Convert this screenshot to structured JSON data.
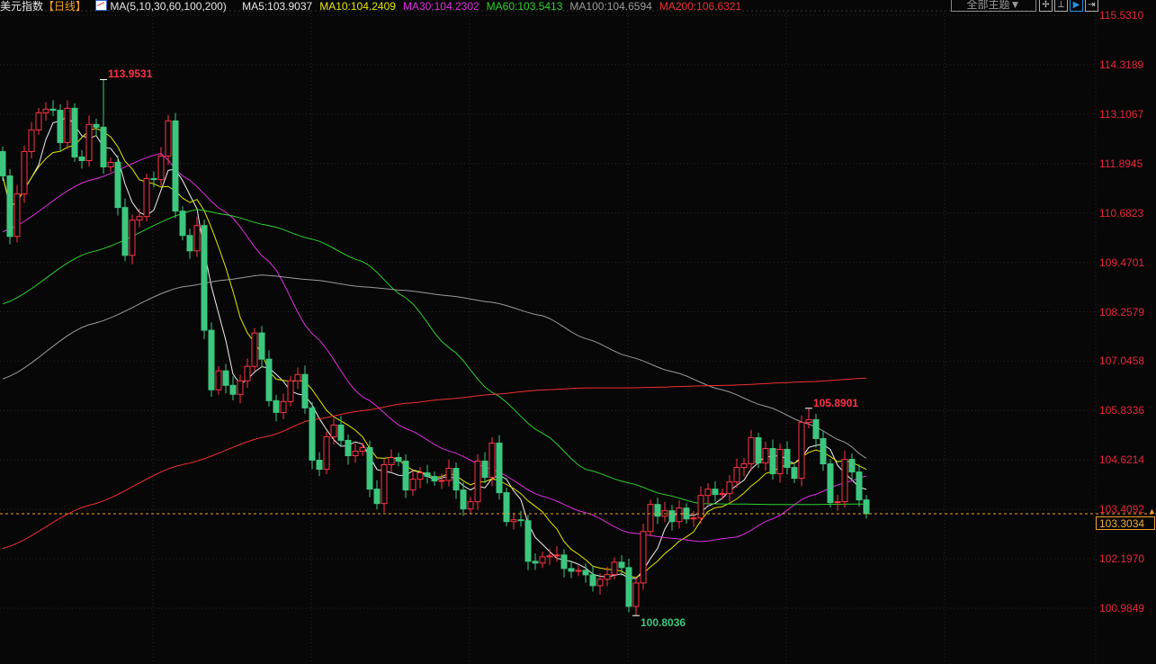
{
  "header": {
    "symbol": "美元指数",
    "period": "【日线】",
    "ma_group": "MA(5,10,30,60,100,200)",
    "ma_labels": [
      {
        "text": "MA5:103.9037",
        "color": "#e6e6e6"
      },
      {
        "text": "MA10:104.2409",
        "color": "#e6e600"
      },
      {
        "text": "MA30:104.2302",
        "color": "#e030e0"
      },
      {
        "text": "MA60:103.5413",
        "color": "#30d030"
      },
      {
        "text": "MA100:104.6594",
        "color": "#9a9a9a"
      },
      {
        "text": "MA200:106.6321",
        "color": "#f03030"
      }
    ],
    "theme_button": "全部主题▼",
    "toolbar_icons": [
      "crosshair-icon",
      "fit-icon",
      "play-icon",
      "expand-right-icon"
    ]
  },
  "colors": {
    "up": "#ff3344",
    "down": "#3cc77f",
    "bg": "#070707",
    "last_price": "#f0a030"
  },
  "chart_data": {
    "type": "candlestick",
    "title": "美元指数 日线",
    "ylim": [
      100.9849,
      115.531
    ],
    "y_ticks": [
      "115.5310",
      "114.3189",
      "113.1067",
      "111.8945",
      "110.6823",
      "109.4701",
      "108.2579",
      "107.0458",
      "105.8336",
      "104.6214",
      "103.4092",
      "102.1970",
      "100.9849"
    ],
    "first_open": 112.188,
    "closes": [
      111.59,
      110.106,
      111.147,
      112.188,
      112.719,
      113.14,
      113.228,
      113.2,
      112.409,
      113.25,
      112.055,
      111.966,
      112.852,
      112.786,
      111.811,
      111.922,
      110.815,
      109.641,
      110.505,
      110.594,
      111.524,
      111.5,
      112.077,
      112.941,
      110.727,
      110.129,
      109.752,
      110.372,
      107.804,
      106.343,
      106.807,
      106.453,
      106.232,
      106.564,
      106.918,
      107.737,
      107.095,
      106.077,
      105.789,
      106.055,
      106.564,
      106.719,
      105.9,
      104.616,
      104.394,
      105.191,
      105.479,
      105.103,
      104.726,
      104.837,
      104.925,
      103.907,
      103.553,
      104.505,
      104.682,
      104.593,
      103.885,
      104.15,
      104.305,
      104.217,
      104.106,
      104.12,
      104.416,
      103.885,
      103.42,
      103.597,
      104.593,
      104.195,
      105.036,
      103.819,
      103.11,
      103.154,
      103.132,
      102.136,
      102.092,
      102.246,
      102.269,
      102.291,
      101.959,
      101.892,
      101.915,
      101.804,
      101.538,
      101.693,
      101.81,
      102.114,
      101.981,
      101.029,
      101.605,
      102.866,
      103.531,
      103.243,
      103.376,
      103.11,
      103.442,
      103.176,
      103.198,
      103.752,
      103.907,
      103.774,
      103.796,
      104.084,
      104.438,
      104.527,
      105.169,
      104.549,
      104.903,
      104.283,
      104.881,
      104.438,
      104.172,
      105.545,
      105.611,
      105.147,
      104.527,
      103.575,
      103.597,
      104.637,
      104.327,
      103.642,
      103.3034
    ],
    "annotations": [
      {
        "index": 14,
        "kind": "high",
        "value": 113.9531,
        "label": "113.9531",
        "color": "#ff3344"
      },
      {
        "index": 88,
        "kind": "low",
        "value": 100.8036,
        "label": "100.8036",
        "color": "#3cc77f"
      },
      {
        "index": 112,
        "kind": "high",
        "value": 105.8901,
        "label": "105.8901",
        "color": "#ff3344"
      }
    ],
    "last_price": {
      "value": 103.3034,
      "label": "103.3034"
    },
    "ma_series": [
      {
        "name": "MA5",
        "period": 5,
        "color": "#f0f0f0"
      },
      {
        "name": "MA10",
        "period": 10,
        "color": "#e6e600"
      },
      {
        "name": "MA30",
        "color": "#e030e0",
        "points": [
          [
            0,
            110.22
          ],
          [
            12,
            111.48
          ],
          [
            22,
            112.14
          ],
          [
            25,
            111.59
          ],
          [
            31,
            110.7
          ],
          [
            37,
            109.49
          ],
          [
            43,
            107.72
          ],
          [
            50,
            106.17
          ],
          [
            56,
            105.39
          ],
          [
            62,
            104.84
          ],
          [
            68,
            104.39
          ],
          [
            75,
            103.73
          ],
          [
            81,
            103.33
          ],
          [
            87,
            102.84
          ],
          [
            93,
            102.7
          ],
          [
            97,
            102.62
          ],
          [
            102,
            102.73
          ],
          [
            107,
            103.18
          ],
          [
            112,
            103.73
          ],
          [
            117,
            104.06
          ],
          [
            120,
            104.23
          ]
        ]
      },
      {
        "name": "MA60",
        "color": "#30d030",
        "points": [
          [
            0,
            108.45
          ],
          [
            12,
            109.71
          ],
          [
            27,
            110.77
          ],
          [
            31,
            110.64
          ],
          [
            37,
            110.37
          ],
          [
            43,
            110.04
          ],
          [
            50,
            109.49
          ],
          [
            56,
            108.6
          ],
          [
            62,
            107.38
          ],
          [
            68,
            106.28
          ],
          [
            75,
            105.28
          ],
          [
            81,
            104.39
          ],
          [
            87,
            104.06
          ],
          [
            92,
            103.77
          ],
          [
            97,
            103.55
          ],
          [
            102,
            103.54
          ],
          [
            107,
            103.53
          ],
          [
            112,
            103.53
          ],
          [
            120,
            103.54
          ]
        ]
      },
      {
        "name": "MA100",
        "color": "#9a9a9a",
        "points": [
          [
            0,
            106.61
          ],
          [
            12,
            107.94
          ],
          [
            25,
            108.87
          ],
          [
            31,
            109.04
          ],
          [
            36,
            109.16
          ],
          [
            43,
            109.04
          ],
          [
            50,
            108.87
          ],
          [
            56,
            108.78
          ],
          [
            62,
            108.65
          ],
          [
            68,
            108.49
          ],
          [
            75,
            108.16
          ],
          [
            81,
            107.6
          ],
          [
            87,
            107.16
          ],
          [
            93,
            106.79
          ],
          [
            100,
            106.34
          ],
          [
            106,
            105.94
          ],
          [
            112,
            105.5
          ],
          [
            117,
            105.06
          ],
          [
            120,
            104.66
          ]
        ]
      },
      {
        "name": "MA200",
        "color": "#f03030",
        "points": [
          [
            0,
            102.45
          ],
          [
            12,
            103.51
          ],
          [
            25,
            104.51
          ],
          [
            37,
            105.21
          ],
          [
            43,
            105.61
          ],
          [
            50,
            105.83
          ],
          [
            56,
            106.01
          ],
          [
            62,
            106.12
          ],
          [
            68,
            106.23
          ],
          [
            75,
            106.34
          ],
          [
            81,
            106.39
          ],
          [
            87,
            106.39
          ],
          [
            100,
            106.45
          ],
          [
            112,
            106.54
          ],
          [
            120,
            106.63
          ]
        ]
      }
    ]
  }
}
